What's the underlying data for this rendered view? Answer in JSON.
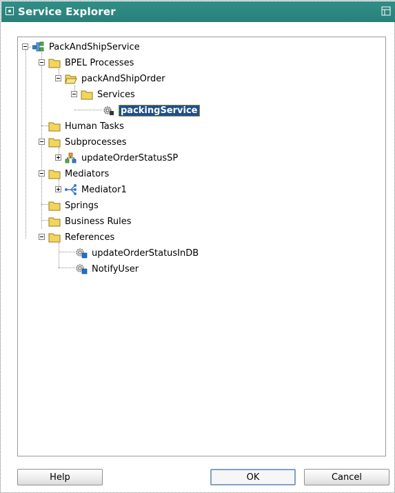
{
  "window": {
    "title": "Service Explorer"
  },
  "tree": {
    "root": "PackAndShipService",
    "bpel_processes": "BPEL Processes",
    "pack_and_ship_order": "packAndShipOrder",
    "services": "Services",
    "packing_service": "packingService",
    "human_tasks": "Human Tasks",
    "subprocesses": "Subprocesses",
    "update_order_status_sp": "updateOrderStatusSP",
    "mediators": "Mediators",
    "mediator1": "Mediator1",
    "springs": "Springs",
    "business_rules": "Business Rules",
    "references": "References",
    "update_order_status_in_db": "updateOrderStatusInDB",
    "notify_user": "NotifyUser"
  },
  "buttons": {
    "help": "Help",
    "ok": "OK",
    "cancel": "Cancel"
  },
  "colors": {
    "titlebar": "#2f8f87",
    "selection": "#1e4f8a",
    "folder": "#f2d55c"
  }
}
